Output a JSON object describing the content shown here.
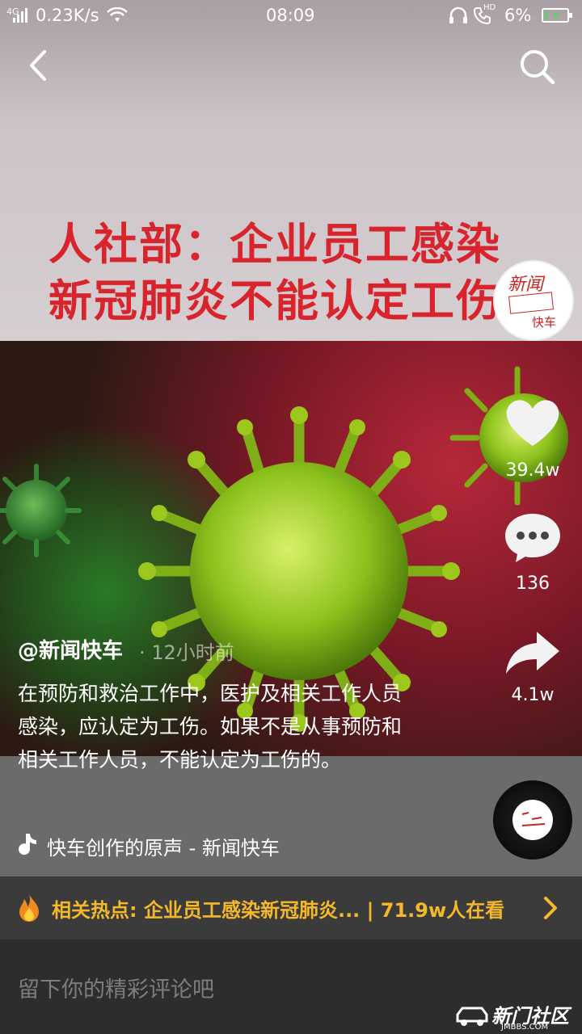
{
  "status_bar": {
    "network": "4G",
    "speed": "0.23K/s",
    "time": "08:09",
    "hd": "HD",
    "battery": "6%"
  },
  "video": {
    "headline_line1": "人社部：企业员工感染",
    "headline_line2": "新冠肺炎不能认定工伤",
    "channel_logo_text_top": "新闻",
    "channel_logo_text_bottom": "快车"
  },
  "actions": {
    "likes": "39.4w",
    "comments": "136",
    "shares": "4.1w"
  },
  "post": {
    "author": "@新闻快车",
    "time": "· 12小时前",
    "caption": "在预防和救治工作中，医护及相关工作人员感染，应认定为工伤。如果不是从事预防和相关工作人员，不能认定为工伤的。",
    "music": "快车创作的原声 - 新闻快车"
  },
  "hot_topic": {
    "text": "相关热点: 企业员工感染新冠肺炎... | 71.9w人在看"
  },
  "comment_box": {
    "placeholder": "留下你的精彩评论吧"
  },
  "watermark": {
    "text": "新门社区",
    "sub": "JMBBS.COM"
  },
  "colors": {
    "headline_red": "#d8242d",
    "hot_yellow": "#f5b82a"
  }
}
